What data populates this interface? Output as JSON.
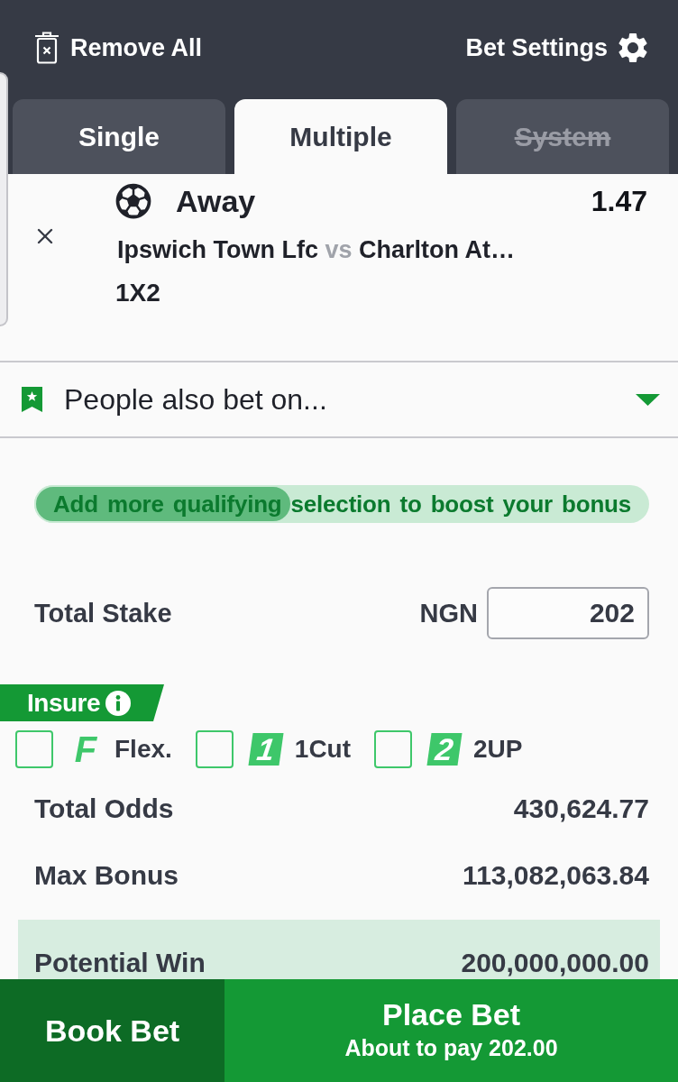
{
  "header": {
    "remove_all": "Remove All",
    "settings": "Bet Settings"
  },
  "tabs": [
    {
      "label": "Single",
      "selected": false,
      "disabled": false
    },
    {
      "label": "Multiple",
      "selected": true,
      "disabled": false
    },
    {
      "label": "System",
      "selected": false,
      "disabled": true
    }
  ],
  "selection": {
    "odds": "1.47",
    "pick": "Away",
    "home": "Ipswich Town Lfc",
    "separator": "vs",
    "away": "Charlton At…",
    "market": "1X2"
  },
  "suggestions": {
    "label": "People also bet on...",
    "expanded": false
  },
  "bonus": {
    "message": "Add more qualifying selection to boost your bonus",
    "level": 0.42
  },
  "stake": {
    "label": "Total Stake",
    "currency": "NGN",
    "value": "202"
  },
  "insure": {
    "label": "Insure",
    "options": [
      {
        "kind": "letter",
        "badge": "F",
        "label": "Flex.",
        "checked": false
      },
      {
        "kind": "tile",
        "badge": "1",
        "label": "1Cut",
        "checked": false
      },
      {
        "kind": "tile",
        "badge": "2",
        "label": "2UP",
        "checked": false
      }
    ]
  },
  "summary": [
    {
      "label": "Total Odds",
      "value": "430,624.77"
    },
    {
      "label": "Max Bonus",
      "value": "113,082,063.84"
    }
  ],
  "potential_win": {
    "label": "Potential Win",
    "value": "200,000,000.00"
  },
  "actions": {
    "book": "Book Bet",
    "place": "Place Bet",
    "pay_note": "About to pay 202.00"
  }
}
